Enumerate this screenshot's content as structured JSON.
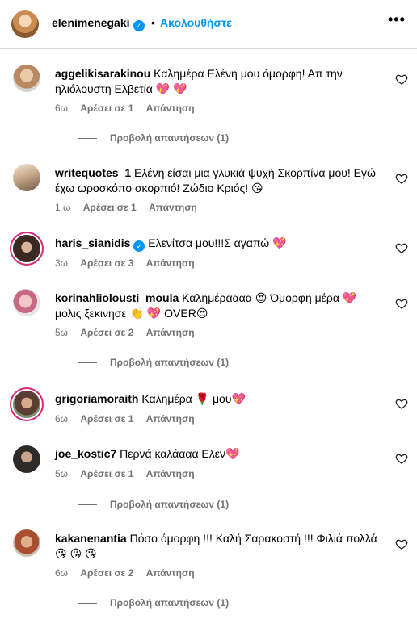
{
  "header": {
    "username": "elenimenegaki",
    "separator": "•",
    "follow_label": "Ακολουθήστε",
    "more_label": "•••"
  },
  "comments": [
    {
      "username": "aggelikisarakinou",
      "text": "Καλημέρα Ελένη μου όμορφη! Απ την ηλιόλουστη Ελβετία 💖 💖",
      "time": "6ω",
      "likes": "Αρέσει σε 1",
      "reply": "Απάντηση",
      "view_replies": "Προβολή απαντήσεων (1)"
    },
    {
      "username": "writequotes_1",
      "text": "Ελένη είσαι μια γλυκιά ψυχή Σκορπίνα μου! Εγώ έχω ωροσκόπο σκορπιό! Ζώδιο Κριός! 😘",
      "time": "1 ω",
      "likes": "Αρέσει σε 1",
      "reply": "Απάντηση"
    },
    {
      "username": "haris_sianidis",
      "text": "Ελενίτσα μου!!!Σ αγαπώ 💖",
      "time": "3ω",
      "likes": "Αρέσει σε 3",
      "reply": "Απάντηση"
    },
    {
      "username": "korinahliolousti_moula",
      "text": "Καλημέραααα 😍 Όμορφη μέρα 💖 μολις ξεκινησε 👏 💖 OVER😍",
      "time": "5ω",
      "likes": "Αρέσει σε 2",
      "reply": "Απάντηση",
      "view_replies": "Προβολή απαντήσεων (1)"
    },
    {
      "username": "grigoriamoraith",
      "text": "Καλημέρα 🌹 μου💖",
      "time": "6ω",
      "likes": "Αρέσει σε 1",
      "reply": "Απάντηση"
    },
    {
      "username": "joe_kostic7",
      "text": "Περνά καλάααα Ελεν💖",
      "time": "5ω",
      "likes": "Αρέσει σε 1",
      "reply": "Απάντηση",
      "view_replies": "Προβολή απαντήσεων (1)"
    },
    {
      "username": "kakanenantia",
      "text": "Πόσο όμορφη !!! Καλή Σαρακοστή !!! Φιλιά πολλά 😘 😘 😘",
      "time": "6ω",
      "likes": "Αρέσει σε 2",
      "reply": "Απάντηση",
      "view_replies": "Προβολή απαντήσεων (1)"
    }
  ],
  "colors": {
    "accent": "#0095f6",
    "meta": "#737373",
    "divider": "#dbdbdb",
    "story_ring": "#d62976"
  }
}
